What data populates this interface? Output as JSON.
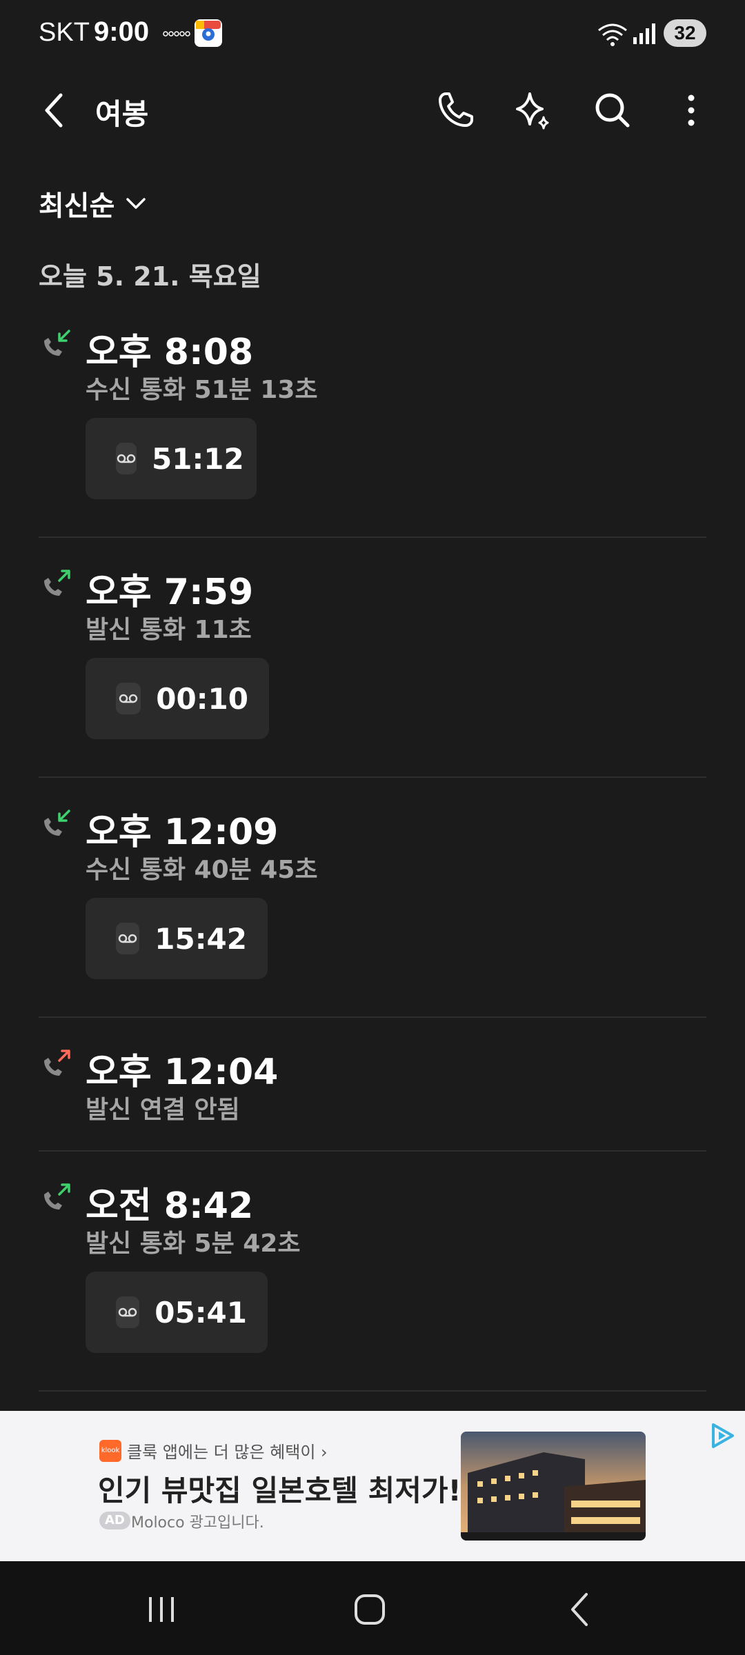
{
  "status_bar": {
    "carrier": "SKT",
    "time": "9:00",
    "battery": "32"
  },
  "app_bar": {
    "title": "여봉"
  },
  "sort": {
    "label": "최신순"
  },
  "date_header": "오늘 5. 21. 목요일",
  "calls": [
    {
      "time": "오후 8:08",
      "desc": "수신 통화 51분 13초",
      "type": "incoming",
      "recording": "51:12"
    },
    {
      "time": "오후 7:59",
      "desc": "발신 통화 11초",
      "type": "outgoing",
      "recording": "00:10"
    },
    {
      "time": "오후 12:09",
      "desc": "수신 통화 40분 45초",
      "type": "incoming",
      "recording": "15:42"
    },
    {
      "time": "오후 12:04",
      "desc": "발신 연결 안됨",
      "type": "outgoing-missed",
      "recording": null
    },
    {
      "time": "오전 8:42",
      "desc": "발신 통화 5분 42초",
      "type": "outgoing",
      "recording": "05:41"
    }
  ],
  "ad": {
    "logo_text": "klook",
    "promo": "클룩 앱에는 더 많은 혜택이 ›",
    "headline": "인기 뷰맛집 일본호텔 최저가!",
    "badge": "AD",
    "source": "Moloco 광고입니다."
  },
  "colors": {
    "background": "#1b1b1b",
    "incoming_arrow": "#3fcf6c",
    "outgoing_arrow": "#3fcf6c",
    "missed_arrow": "#ff6b5b",
    "phone_icon": "#8a8a8a"
  },
  "icons": {
    "back": "chevron-left-icon",
    "call": "phone-icon",
    "ai": "sparkle-icon",
    "search": "search-icon",
    "more": "more-vertical-icon",
    "recording": "voicemail-icon"
  }
}
